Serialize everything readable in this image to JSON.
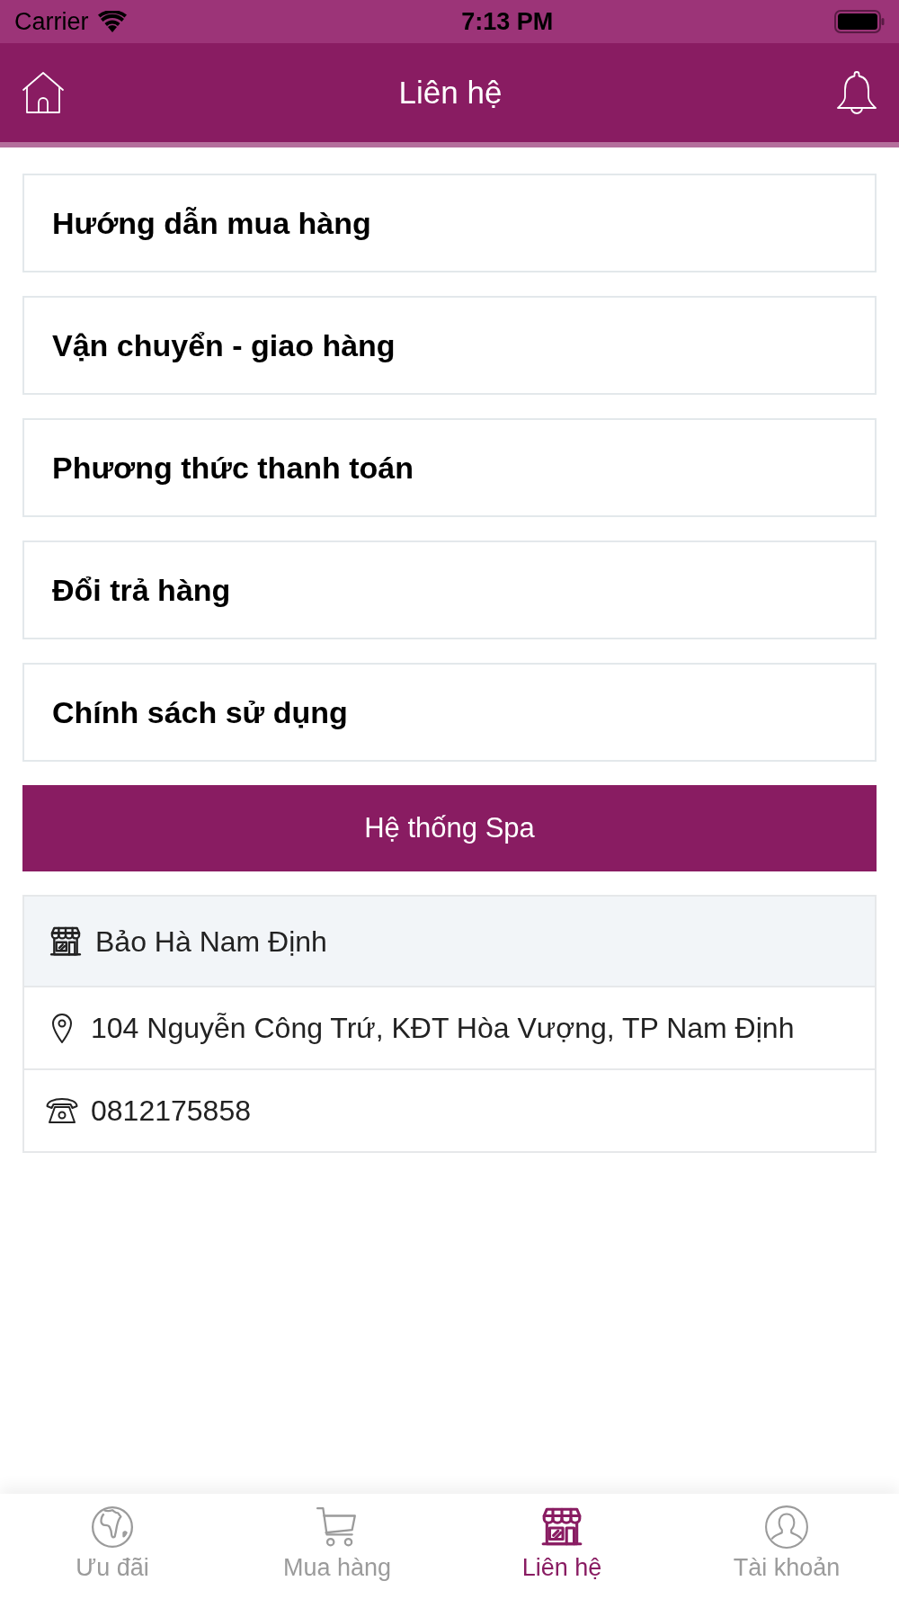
{
  "status_bar": {
    "carrier": "Carrier",
    "time": "7:13 PM"
  },
  "header": {
    "title": "Liên hệ"
  },
  "menu_items": [
    {
      "label": "Hướng dẫn mua hàng"
    },
    {
      "label": "Vận chuyển - giao hàng"
    },
    {
      "label": "Phương thức thanh toán"
    },
    {
      "label": "Đổi trả hàng"
    },
    {
      "label": "Chính sách sử dụng"
    }
  ],
  "spa_button": {
    "label": "Hệ thống Spa"
  },
  "spa_card": {
    "name": "Bảo Hà Nam Định",
    "address": "104 Nguyễn Công Trứ, KĐT Hòa Vượng, TP Nam Định",
    "phone": "0812175858"
  },
  "tab_bar": [
    {
      "label": "Ưu đãi",
      "selected": false
    },
    {
      "label": "Mua hàng",
      "selected": false
    },
    {
      "label": "Liên hệ",
      "selected": true
    },
    {
      "label": "Tài khoản",
      "selected": false
    }
  ]
}
